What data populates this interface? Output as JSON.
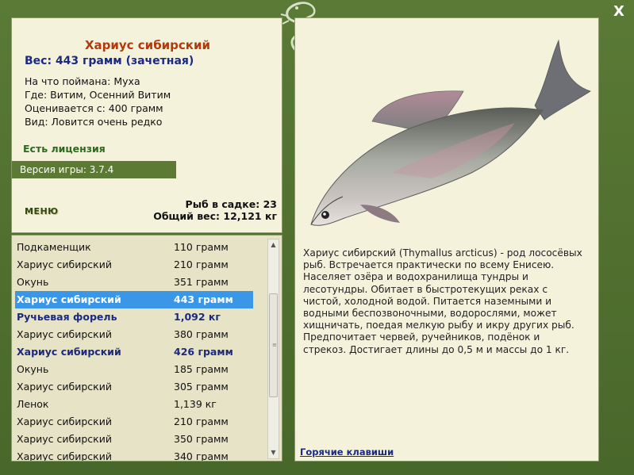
{
  "window": {
    "close_label": "X"
  },
  "fish": {
    "title": "Хариус сибирский",
    "weight": "Вес: 443 грамм (зачетная)",
    "caught_with": "На что поймана: Муха",
    "where": "Где: Витим, Осенний Витим",
    "valued_from": "Оценивается с: 400 грамм",
    "kind": "Вид: Ловится очень редко"
  },
  "license": "Есть лицензия",
  "version": "Версия игры: 3.7.4",
  "menu_label": "МЕНЮ",
  "stats": {
    "fish_in_tank": "Рыб в садке: 23",
    "total_weight": "Общий вес: 12,121 кг"
  },
  "list": [
    {
      "name": "Подкаменщик",
      "weight": "110 грамм"
    },
    {
      "name": "Хариус сибирский",
      "weight": "210 грамм"
    },
    {
      "name": "Окунь",
      "weight": "351 грамм"
    },
    {
      "name": "Хариус сибирский",
      "weight": "443 грамм",
      "selected": true
    },
    {
      "name": "Ручьевая форель",
      "weight": "1,092 кг",
      "bold": true
    },
    {
      "name": "Хариус сибирский",
      "weight": "380 грамм"
    },
    {
      "name": "Хариус сибирский",
      "weight": "426 грамм",
      "bold": true
    },
    {
      "name": "Окунь",
      "weight": "185 грамм"
    },
    {
      "name": "Хариус сибирский",
      "weight": "305 грамм"
    },
    {
      "name": "Ленок",
      "weight": "1,139 кг"
    },
    {
      "name": "Хариус сибирский",
      "weight": "210 грамм"
    },
    {
      "name": "Хариус сибирский",
      "weight": "350 грамм"
    },
    {
      "name": "Хариус сибирский",
      "weight": "340 грамм"
    }
  ],
  "description": [
    "Хариус сибирский (Thymallus arcticus) - род лососёвых",
    "рыб. Встречается практически по всему Енисею.",
    "Населяет озёра и водохранилища тундры и",
    "лесотундры. Обитает в быстротекущих реках с",
    "чистой, холодной водой. Питается наземными и",
    "водными беспозвоночными, водорослями, может",
    "хищничать, поедая мелкую рыбу и икру других рыб.",
    "Предпочитает червей, ручейников, подёнок и",
    "стрекоз. Достигает длины до 0,5 м и массы до 1 кг."
  ],
  "hotkeys_label": "Горячие клавиши",
  "colors": {
    "frame": "#4f6e2f",
    "panel": "#f5f2dc",
    "title": "#b03a0c",
    "accent_blue": "#1b2a80",
    "selection": "#3a97e8"
  }
}
